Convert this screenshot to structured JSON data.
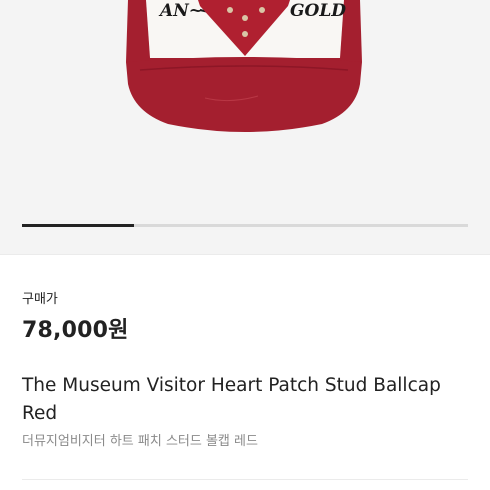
{
  "product": {
    "price_label": "구매가",
    "price": "78,000원",
    "title": "The Museum Visitor Heart Patch Stud Ballcap Red",
    "subtitle": "더뮤지엄비지터 하트 패치 스터드 볼캡 레드",
    "image_carousel": {
      "progress": 0.25
    },
    "cap_embroidery_text": "AN... GOLD"
  },
  "colors": {
    "cap_red": "#a41f2f",
    "cap_white": "#f9f7f4",
    "text": "#222222",
    "muted": "#8a8a8a"
  }
}
